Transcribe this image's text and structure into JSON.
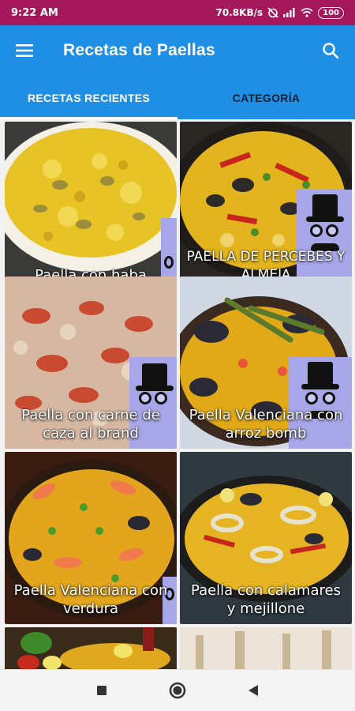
{
  "status": {
    "time": "9:22 AM",
    "speed": "70.8KB/s",
    "battery": "100"
  },
  "app": {
    "title": "Recetas de Paellas"
  },
  "tabs": [
    {
      "label": "RECETAS RECIENTES",
      "active": true
    },
    {
      "label": "CATEGORÍA",
      "active": false
    }
  ],
  "recipes": [
    {
      "label": "Paella con haba"
    },
    {
      "label": "PAELLA DE PERCEBES Y ALMEJA"
    },
    {
      "label": "Paella con carne de caza al brand"
    },
    {
      "label": "Paella Valenciana con arroz bomb"
    },
    {
      "label": "Paella Valenciana con verdura"
    },
    {
      "label": "Paella con calamares y mejillone"
    }
  ],
  "icons": {
    "menu": "hamburger-menu-icon",
    "search": "search-icon",
    "nav_recent": "square-icon",
    "nav_home": "circle-icon",
    "nav_back": "back-triangle-icon"
  },
  "colors": {
    "status_bar": "#a4175a",
    "app_bar": "#1e8fe4",
    "tab_inactive_text": "#0e2236"
  }
}
